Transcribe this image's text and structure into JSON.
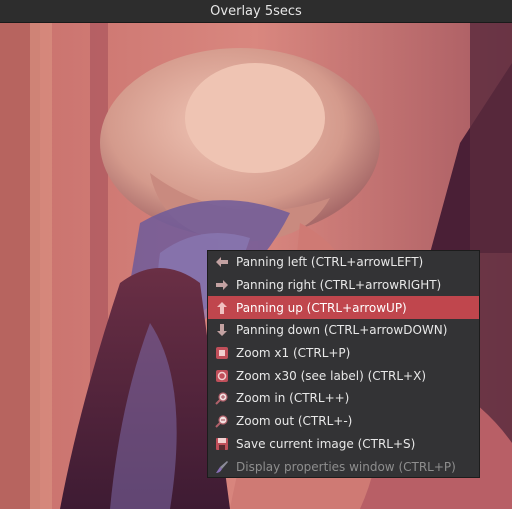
{
  "window": {
    "title": "Overlay 5secs"
  },
  "context_menu": {
    "items": [
      {
        "label": "Panning left (CTRL+arrowLEFT)",
        "icon": "arrow-left-icon",
        "state": "normal"
      },
      {
        "label": "Panning right (CTRL+arrowRIGHT)",
        "icon": "arrow-right-icon",
        "state": "normal"
      },
      {
        "label": "Panning up (CTRL+arrowUP)",
        "icon": "arrow-up-icon",
        "state": "highlighted"
      },
      {
        "label": "Panning down (CTRL+arrowDOWN)",
        "icon": "arrow-down-icon",
        "state": "normal"
      },
      {
        "label": "Zoom x1 (CTRL+P)",
        "icon": "zoom-x1-icon",
        "state": "normal"
      },
      {
        "label": "Zoom x30 (see label) (CTRL+X)",
        "icon": "zoom-x30-icon",
        "state": "normal"
      },
      {
        "label": "Zoom in (CTRL++)",
        "icon": "zoom-in-icon",
        "state": "normal"
      },
      {
        "label": "Zoom out (CTRL+-)",
        "icon": "zoom-out-icon",
        "state": "normal"
      },
      {
        "label": "Save current image (CTRL+S)",
        "icon": "save-icon",
        "state": "normal"
      },
      {
        "label": "Display properties window (CTRL+P)",
        "icon": "brush-icon",
        "state": "disabled"
      }
    ]
  },
  "colors": {
    "menu_background": "#333335",
    "highlight": "#c0464d",
    "title_bar": "#2d2d2d"
  }
}
